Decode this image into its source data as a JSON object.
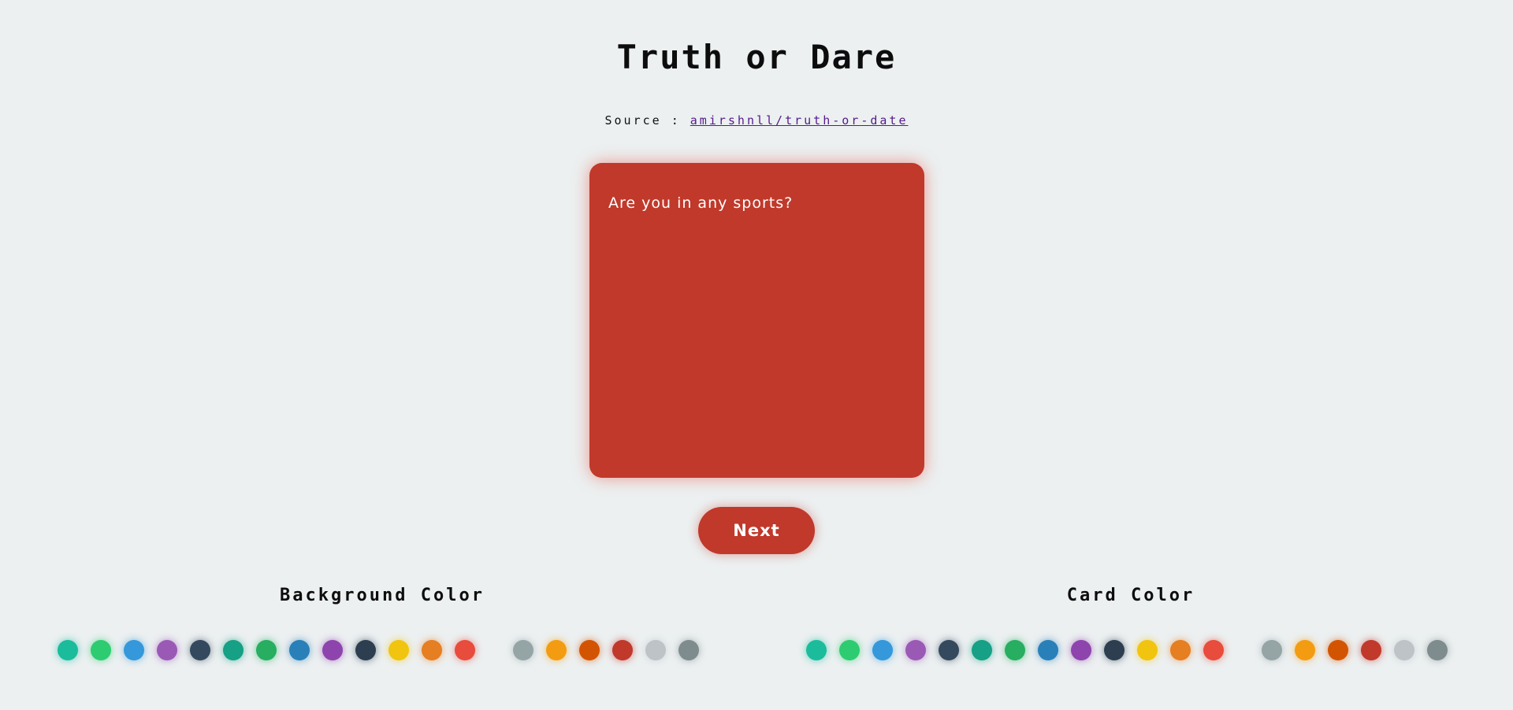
{
  "header": {
    "title": "Truth or Dare",
    "source_label": "Source :",
    "source_link": "amirshnll/truth-or-date"
  },
  "card": {
    "question": "Are you in any sports?",
    "color": "#c0392b"
  },
  "actions": {
    "next_label": "Next"
  },
  "background_color": {
    "label": "Background Color",
    "swatches": [
      "#1abc9c",
      "#2ecc71",
      "#3498db",
      "#9b59b6",
      "#34495e",
      "#16a085",
      "#27ae60",
      "#2980b9",
      "#8e44ad",
      "#2c3e50",
      "#f1c40f",
      "#e67e22",
      "#e74c3c",
      "#95a5a6",
      "#f39c12",
      "#d35400",
      "#c0392b",
      "#bdc3c7",
      "#7f8c8d"
    ]
  },
  "card_color": {
    "label": "Card Color",
    "swatches": [
      "#1abc9c",
      "#2ecc71",
      "#3498db",
      "#9b59b6",
      "#34495e",
      "#16a085",
      "#27ae60",
      "#2980b9",
      "#8e44ad",
      "#2c3e50",
      "#f1c40f",
      "#e67e22",
      "#e74c3c",
      "#95a5a6",
      "#f39c12",
      "#d35400",
      "#c0392b",
      "#bdc3c7",
      "#7f8c8d"
    ]
  },
  "theme": {
    "page_background": "#ecf0f1",
    "link_color": "#551a8b"
  }
}
